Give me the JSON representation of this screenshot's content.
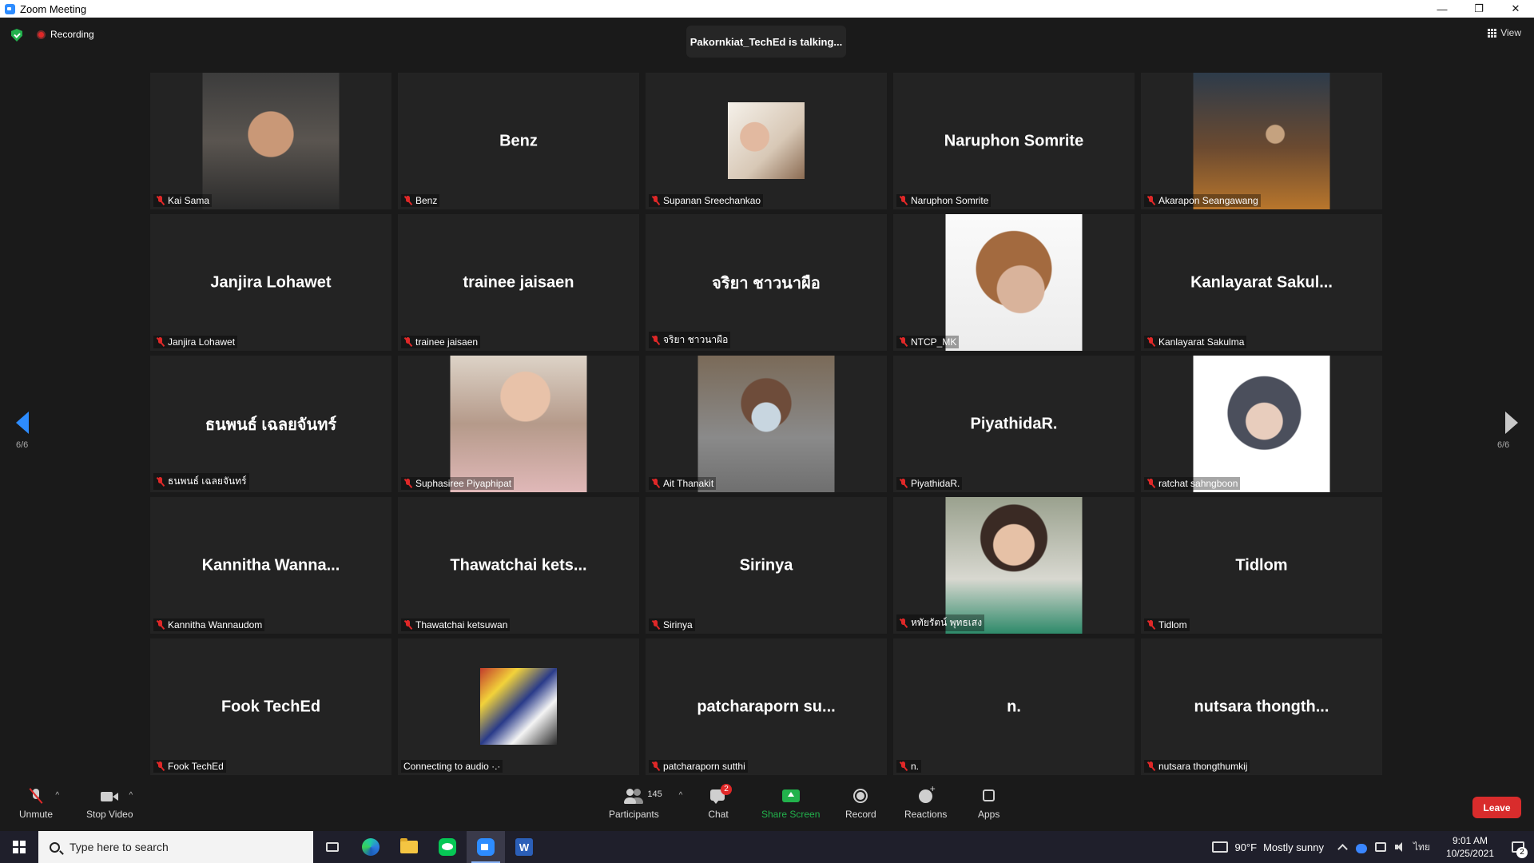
{
  "window": {
    "title": "Zoom Meeting",
    "controls": {
      "minimize": "—",
      "restore": "❐",
      "close": "✕"
    }
  },
  "header": {
    "recording_label": "Recording",
    "talking_text": "Pakornkiat_TechEd is talking...",
    "view_label": "View"
  },
  "pagination": {
    "left": "6/6",
    "right": "6/6"
  },
  "tiles": [
    {
      "display_name": "",
      "label": "Kai Sama",
      "muted": true,
      "photo": "ph-1"
    },
    {
      "display_name": "Benz",
      "label": "Benz",
      "muted": true
    },
    {
      "display_name": "",
      "label": "Supanan Sreechankao",
      "muted": true,
      "photo": "ph-2",
      "photo_small": true
    },
    {
      "display_name": "Naruphon Somrite",
      "label": "Naruphon Somrite",
      "muted": true
    },
    {
      "display_name": "",
      "label": "Akarapon Seangawang",
      "muted": true,
      "photo": "ph-3"
    },
    {
      "display_name": "Janjira Lohawet",
      "label": "Janjira Lohawet",
      "muted": true
    },
    {
      "display_name": "trainee jaisaen",
      "label": "trainee jaisaen",
      "muted": true
    },
    {
      "display_name": "จริยา ชาวนาผือ",
      "label": "จริยา ชาวนาผือ",
      "muted": true
    },
    {
      "display_name": "",
      "label": "NTCP_MK",
      "muted": true,
      "photo": "ph-4"
    },
    {
      "display_name": "Kanlayarat Sakul...",
      "label": "Kanlayarat Sakulma",
      "muted": true
    },
    {
      "display_name": "ธนพนธ์ เฉลยจันทร์",
      "label": "ธนพนธ์ เฉลยจันทร์",
      "muted": true
    },
    {
      "display_name": "",
      "label": "Suphasiree Piyaphipat",
      "muted": true,
      "photo": "ph-5"
    },
    {
      "display_name": "",
      "label": "Ait Thanakit",
      "muted": true,
      "photo": "ph-6"
    },
    {
      "display_name": "PiyathidaR.",
      "label": "PiyathidaR.",
      "muted": true
    },
    {
      "display_name": "",
      "label": "ratchat sahngboon",
      "muted": true,
      "photo": "ph-7"
    },
    {
      "display_name": "Kannitha  Wanna...",
      "label": "Kannitha Wannaudom",
      "muted": true
    },
    {
      "display_name": "Thawatchai  kets...",
      "label": "Thawatchai ketsuwan",
      "muted": true
    },
    {
      "display_name": "Sirinya",
      "label": "Sirinya",
      "muted": true
    },
    {
      "display_name": "",
      "label": "หทัยรัตน์ พุทธเสง",
      "muted": true,
      "photo": "ph-8"
    },
    {
      "display_name": "Tidlom",
      "label": "Tidlom",
      "muted": true
    },
    {
      "display_name": "Fook TechEd",
      "label": "Fook TechEd",
      "muted": true
    },
    {
      "display_name": "",
      "label": "Connecting to audio ·.·",
      "muted": false,
      "photo": "ph-9",
      "photo_small": true
    },
    {
      "display_name": "patcharaporn  su...",
      "label": "patcharaporn sutthi",
      "muted": true
    },
    {
      "display_name": "n.",
      "label": "n.",
      "muted": true
    },
    {
      "display_name": "nutsara  thongth...",
      "label": "nutsara thongthumkij",
      "muted": true
    }
  ],
  "toolbar": {
    "unmute": "Unmute",
    "stop_video": "Stop Video",
    "participants": "Participants",
    "participants_count": "145",
    "chat": "Chat",
    "chat_badge": "2",
    "share_screen": "Share Screen",
    "record": "Record",
    "reactions": "Reactions",
    "apps": "Apps",
    "leave": "Leave",
    "caret": "^"
  },
  "taskbar": {
    "search_placeholder": "Type here to search",
    "word_letter": "W",
    "weather_temp": "90°F",
    "weather_text": "Mostly sunny",
    "ime": "ไทย",
    "time": "9:01 AM",
    "date": "10/25/2021",
    "notification_count": "2"
  },
  "colors": {
    "accent": "#2d8cff",
    "share_green": "#22b24c",
    "leave_red": "#d92c2c",
    "mute_red": "#e02828"
  }
}
